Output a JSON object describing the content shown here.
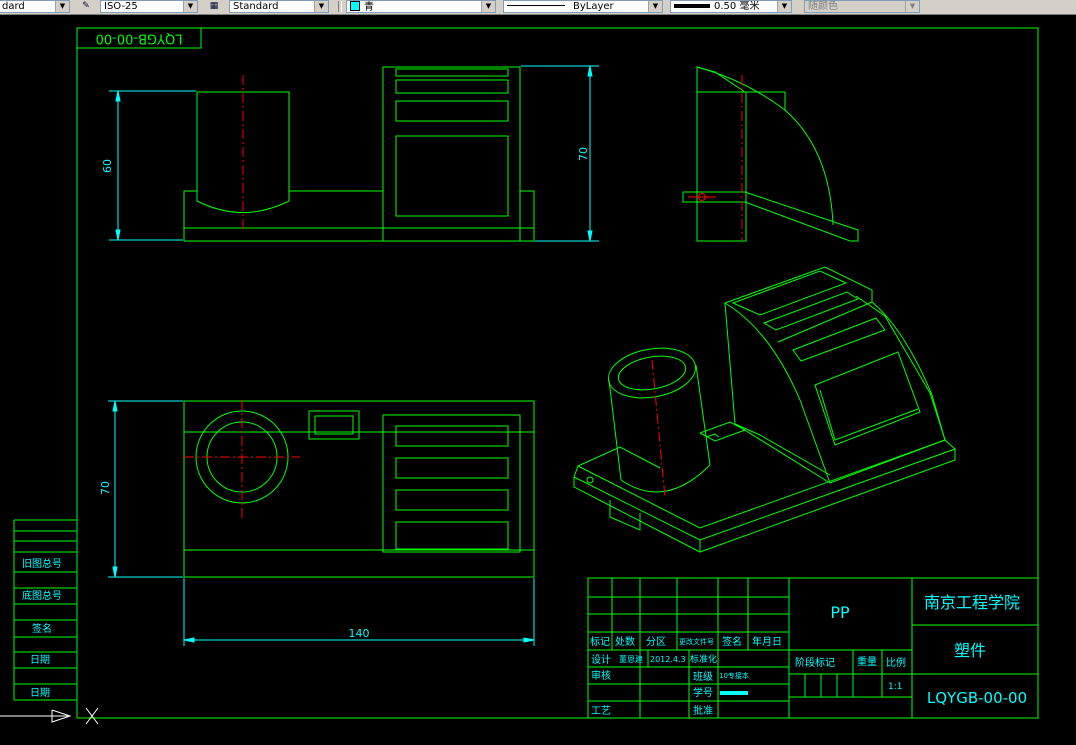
{
  "toolbar": {
    "text_style": "dard",
    "dim_style": "ISO-25",
    "table_style": "Standard",
    "color": "青",
    "linetype": "ByLayer",
    "lineweight": "0.50 毫米",
    "plot_style": "随颜色"
  },
  "drawing": {
    "stamp": "LQYGB-00-00",
    "dim_60": "60",
    "dim_70_front": "70",
    "dim_70_top": "70",
    "dim_140": "140"
  },
  "side_table": [
    "旧图总号",
    "底图总号",
    "签名",
    "日期",
    "日期"
  ],
  "title_block": {
    "header_row": [
      "标记",
      "处数",
      "分区",
      "更改文件号",
      "签名",
      "年月日"
    ],
    "design_label": "设计",
    "designer": "董恩建",
    "date": "2012.4.3",
    "standardize_label": "标准化",
    "review_label": "审核",
    "class_label": "班级",
    "class_value": "10专接本",
    "student_no_label": "学号",
    "process_label": "工艺",
    "approve_label": "批准",
    "material": "PP",
    "stage_label": "阶段标记",
    "weight_label": "重量",
    "scale_label": "比例",
    "scale_value": "1:1",
    "school": "南京工程学院",
    "part_name": "塑件",
    "drawing_no": "LQYGB-00-00"
  }
}
